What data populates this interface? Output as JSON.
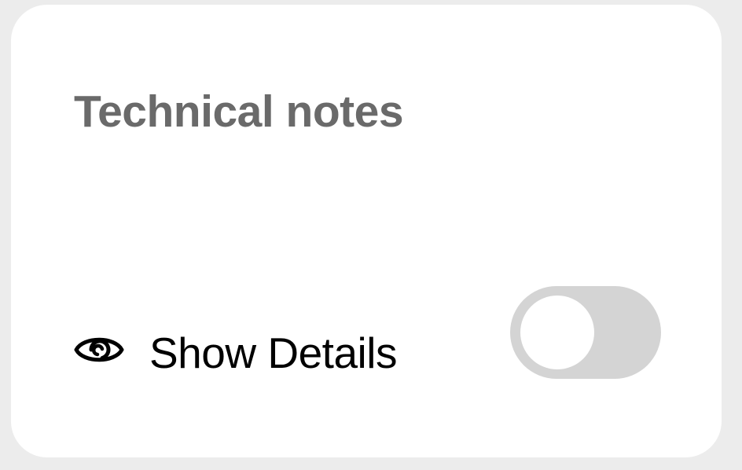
{
  "card": {
    "title": "Technical notes",
    "details_toggle": {
      "label": "Show Details",
      "icon": "eye-icon",
      "checked": false,
      "track_color": "#d4d4d4",
      "knob_color": "#ffffff"
    }
  },
  "colors": {
    "page_background": "#ececec",
    "card_background": "#ffffff",
    "title_color": "#6a6a6a",
    "label_color": "#000000"
  }
}
